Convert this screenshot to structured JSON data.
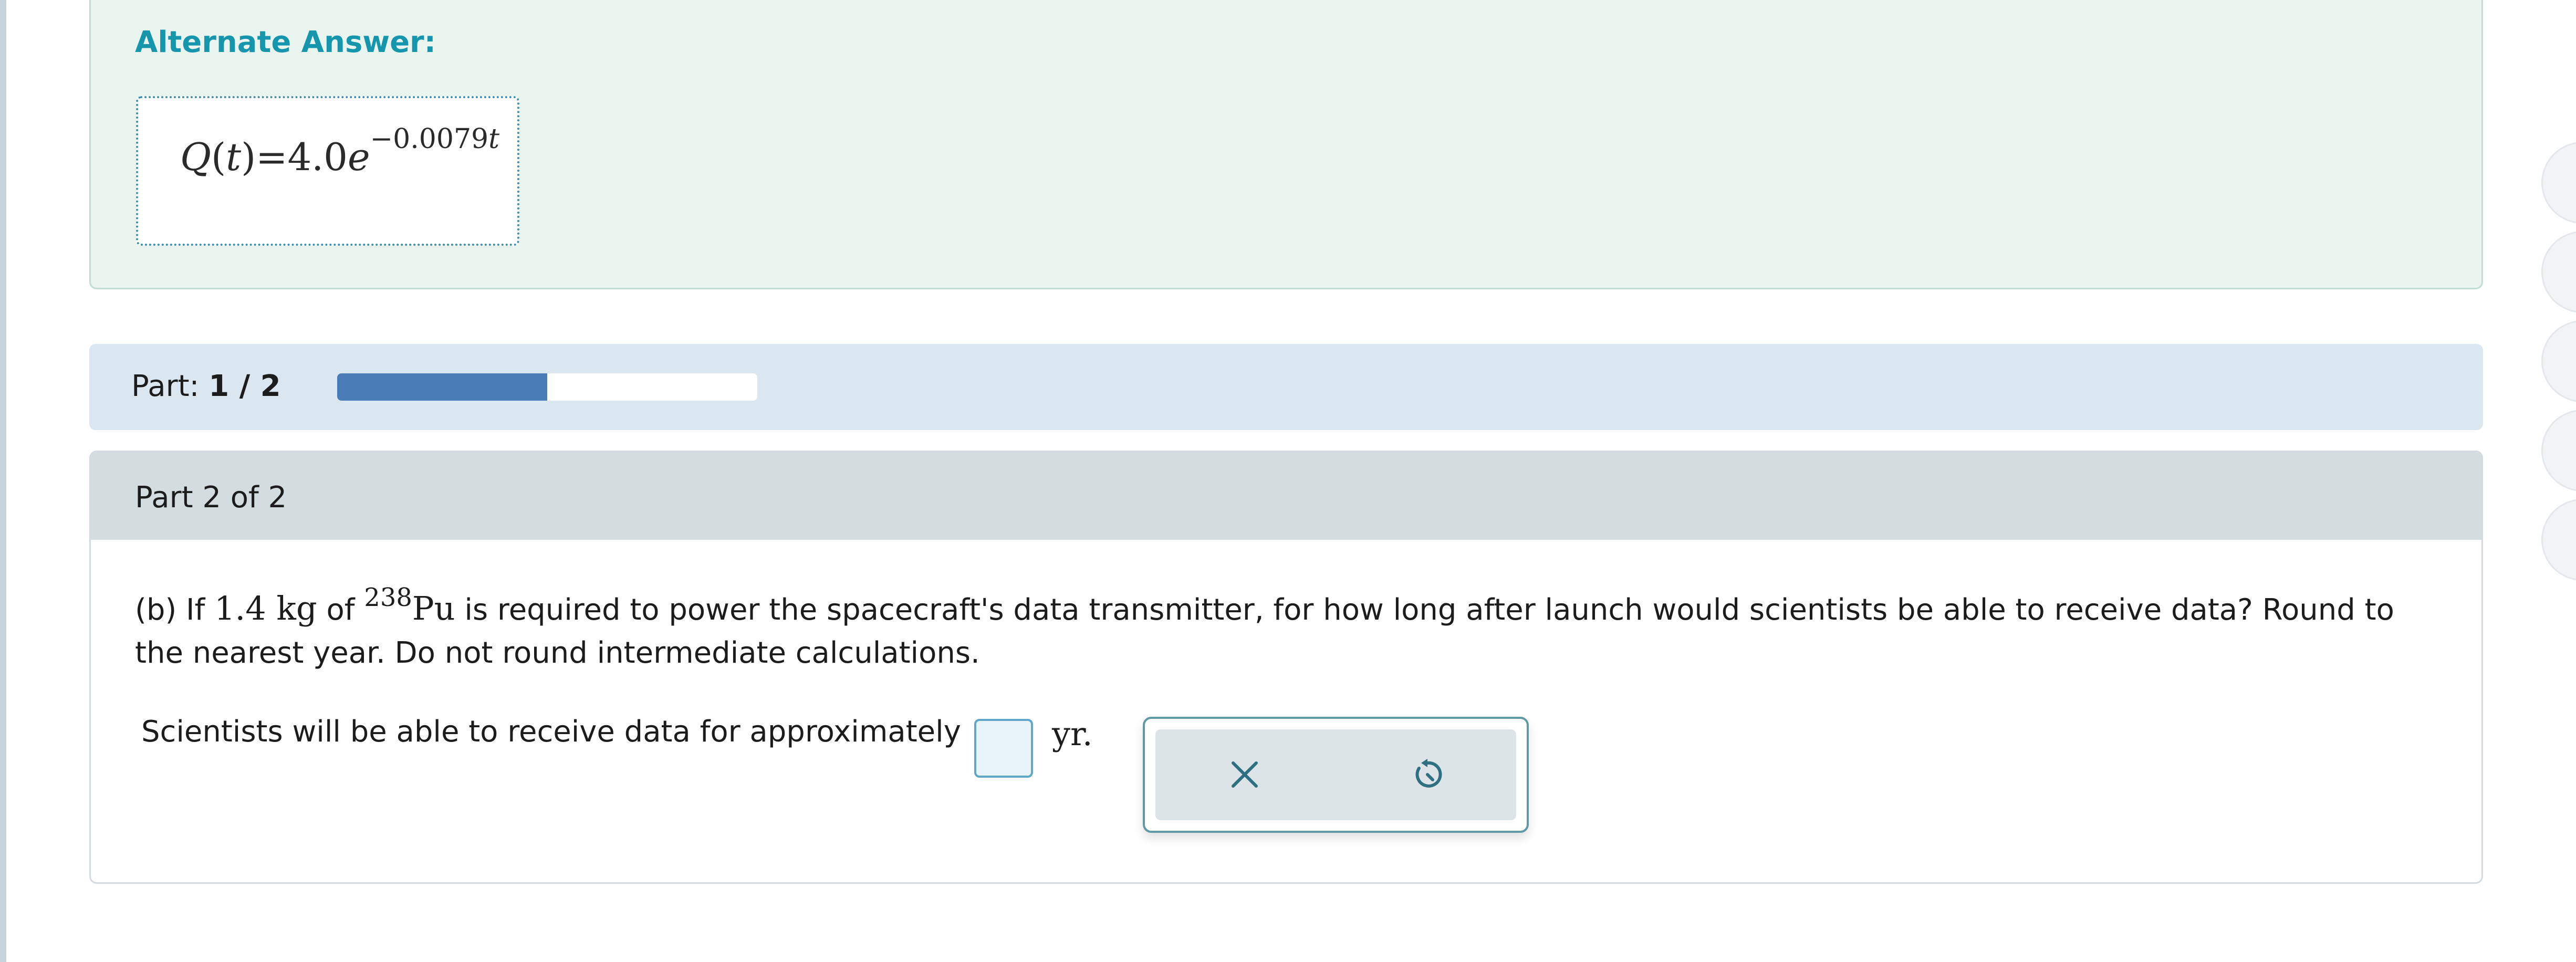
{
  "alternate_answer": {
    "title": "Alternate Answer:",
    "equation": {
      "fn": "Q",
      "var": "t",
      "equals": "=4.0",
      "base": "e",
      "exponent": "−0.0079",
      "exp_var": "t"
    }
  },
  "progress": {
    "label": "Part:",
    "value": "1 / 2",
    "fraction": 0.5
  },
  "part": {
    "title": "Part 2 of 2",
    "question": {
      "prefix": "(b) If",
      "mass": "1.4 kg",
      "of": "of",
      "isotope_mass": "238",
      "isotope": "Pu",
      "rest": "is required to power the spacecraft's data transmitter, for how long after launch would scientists be able to receive data? Round to the nearest year. Do not round intermediate calculations."
    },
    "answer_sentence": "Scientists will be able to receive data for approximately",
    "answer_value": "",
    "unit": "yr."
  },
  "tools": {
    "clear_icon": "close-icon",
    "undo_icon": "undo-icon"
  },
  "colors": {
    "accent_teal": "#1596ad",
    "progress_fill": "#4a7db8",
    "alt_panel_bg": "#eaf5f0",
    "part_bar_bg": "#dbe7f0",
    "card_header_bg": "#d3dcdf"
  }
}
